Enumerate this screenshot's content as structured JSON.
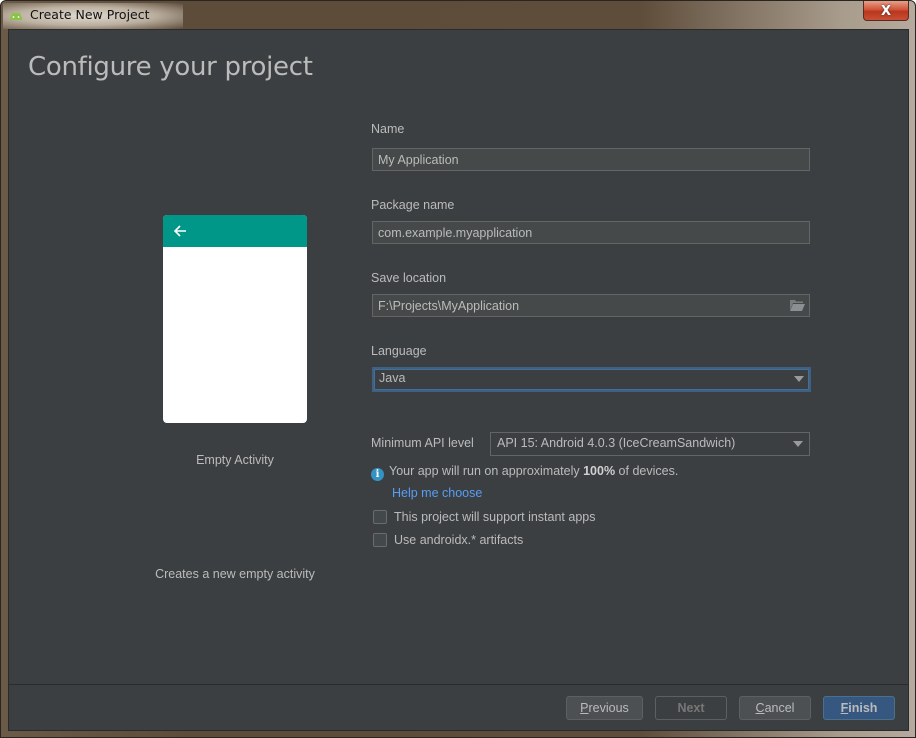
{
  "window": {
    "title": "Create New Project",
    "close_label": "X"
  },
  "page": {
    "heading": "Configure your project"
  },
  "template": {
    "name": "Empty Activity",
    "description": "Creates a new empty activity",
    "toolbar_color": "#009688"
  },
  "form": {
    "name": {
      "label": "Name",
      "value": "My Application"
    },
    "package": {
      "label": "Package name",
      "value": "com.example.myapplication"
    },
    "save_location": {
      "label": "Save location",
      "value": "F:\\Projects\\MyApplication"
    },
    "language": {
      "label": "Language",
      "selected": "Java"
    },
    "min_api": {
      "label": "Minimum API level",
      "selected": "API 15: Android 4.0.3 (IceCreamSandwich)"
    },
    "info": {
      "prefix": "Your app will run on approximately ",
      "percent": "100%",
      "suffix": " of devices."
    },
    "help_link": "Help me choose",
    "checkboxes": [
      {
        "label": "This project will support instant apps",
        "checked": false
      },
      {
        "label": "Use androidx.* artifacts",
        "checked": false
      }
    ]
  },
  "footer": {
    "previous": {
      "mnemonic": "P",
      "rest": "revious"
    },
    "next": "Next",
    "cancel": {
      "mnemonic": "C",
      "rest": "ancel"
    },
    "finish": {
      "mnemonic": "F",
      "rest": "inish"
    }
  }
}
